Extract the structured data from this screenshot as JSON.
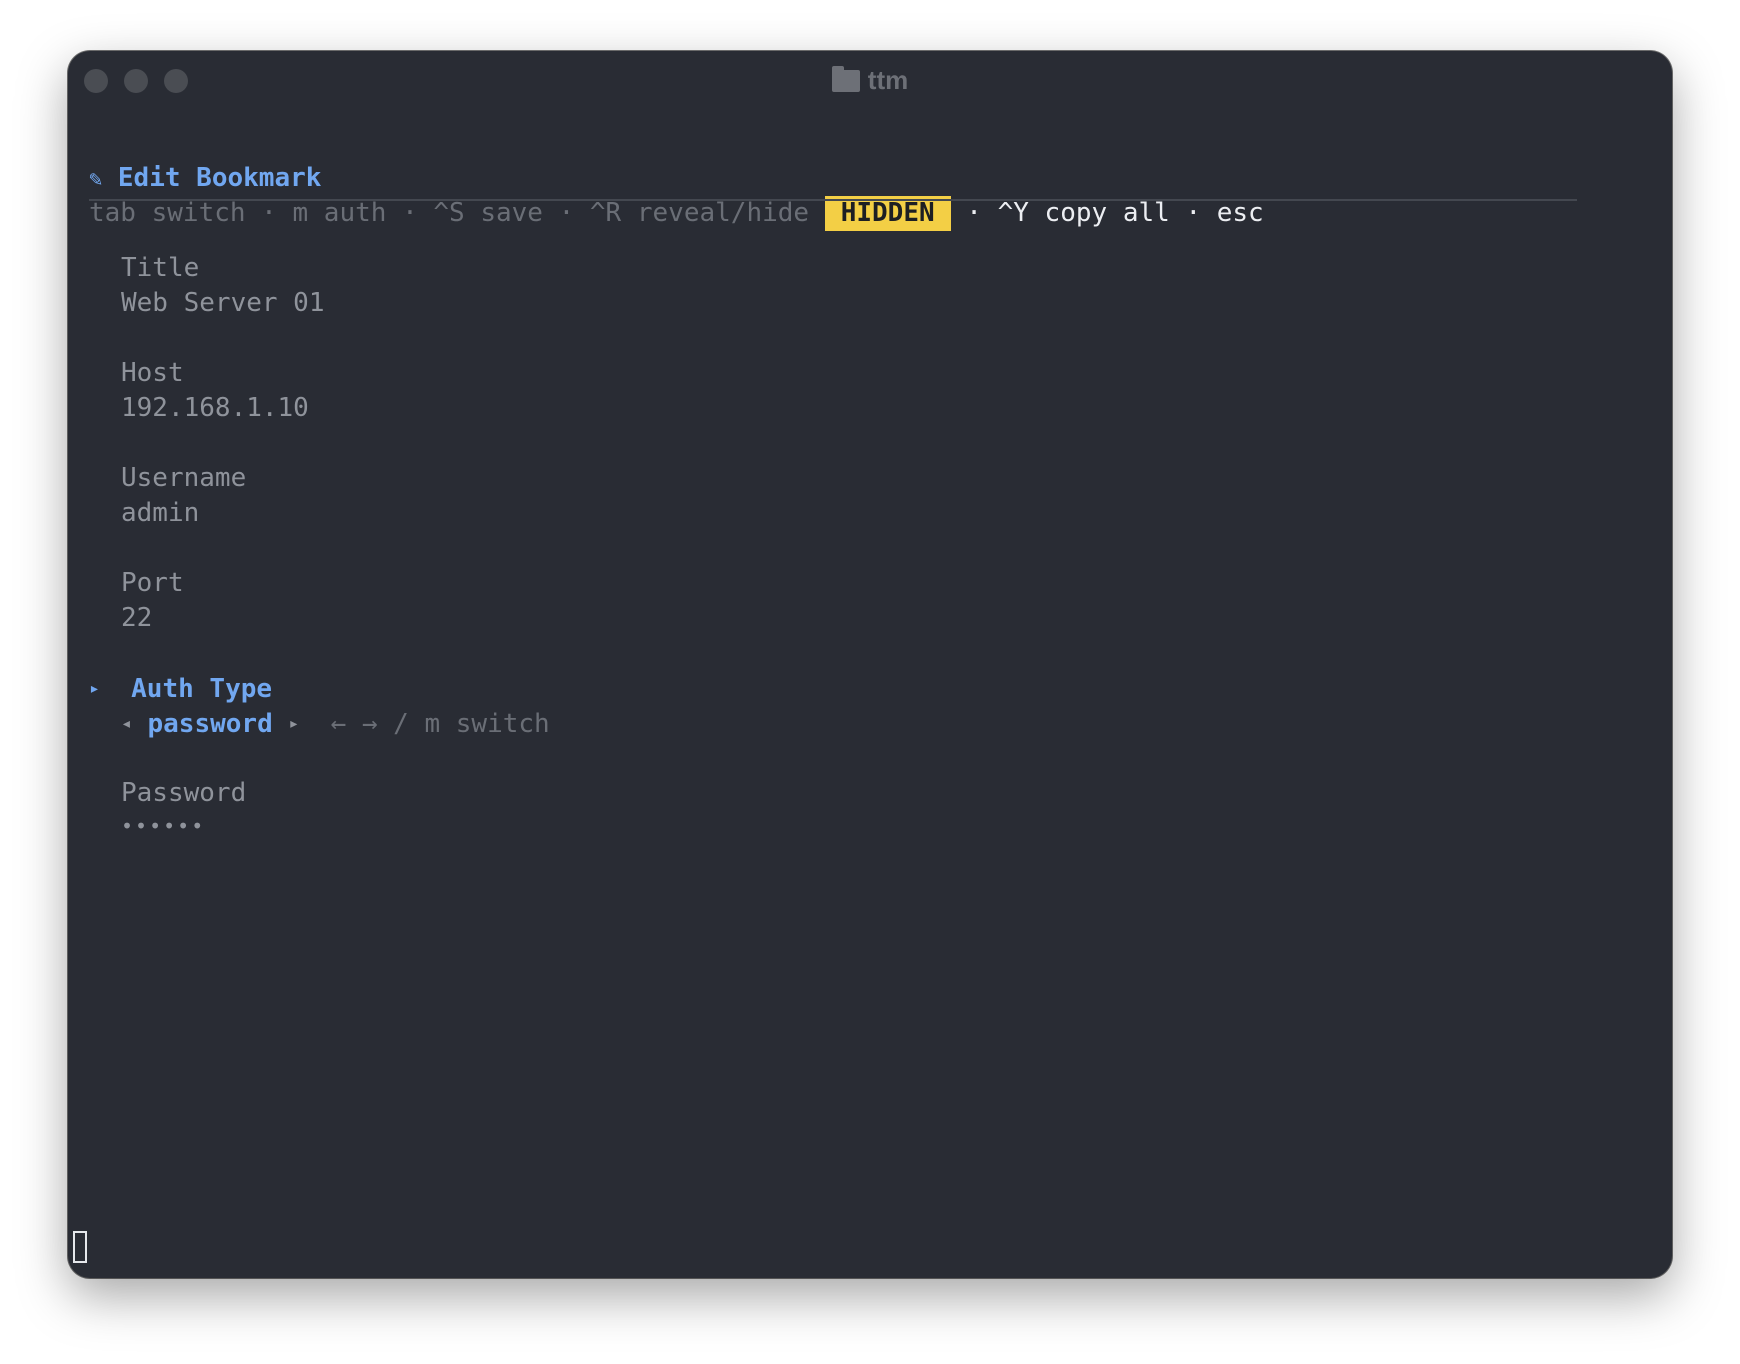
{
  "window": {
    "title": "ttm"
  },
  "header": {
    "icon_glyph": "✎",
    "title": "Edit Bookmark"
  },
  "hints": {
    "part1": "tab switch · m auth · ^S save · ^R reveal/hide ",
    "badge": "HIDDEN",
    "part2": " · ^Y copy all · esc"
  },
  "fields": {
    "title": {
      "label": "Title",
      "value": "Web Server 01"
    },
    "host": {
      "label": "Host",
      "value": "192.168.1.10"
    },
    "username": {
      "label": "Username",
      "value": "admin"
    },
    "port": {
      "label": "Port",
      "value": "22"
    },
    "auth_type": {
      "marker": "▸",
      "label": "Auth Type",
      "left_arrow": "◂",
      "value": "password",
      "right_arrow": "▸",
      "hint": "← → / m switch"
    },
    "password": {
      "label": "Password",
      "value": "••••••"
    }
  },
  "colors": {
    "background": "#292c34",
    "accent_blue": "#71a7f0",
    "badge_yellow": "#f3cf45",
    "text_gray": "#8f939b"
  }
}
